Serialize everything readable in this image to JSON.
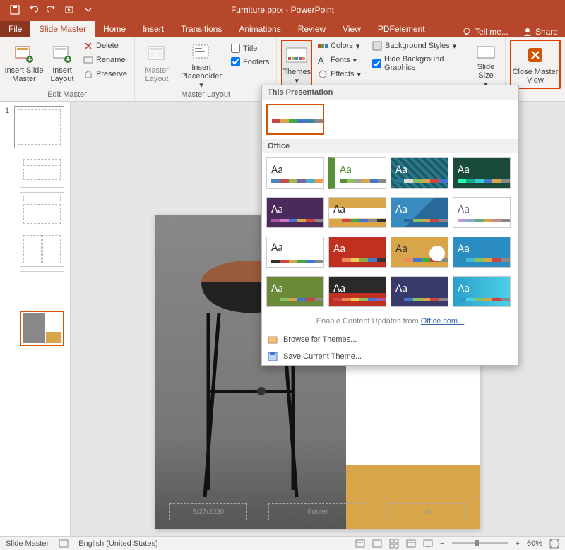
{
  "titlebar": {
    "filename": "Furniture.pptx - PowerPoint"
  },
  "tabs": {
    "file": "File",
    "slide_master": "Slide Master",
    "home": "Home",
    "insert": "Insert",
    "transitions": "Transitions",
    "animations": "Animations",
    "review": "Review",
    "view": "View",
    "pdfelement": "PDFelement",
    "tell_me": "Tell me...",
    "share": "Share"
  },
  "ribbon": {
    "edit_master": {
      "insert_slide_master": "Insert Slide Master",
      "insert_layout": "Insert Layout",
      "delete": "Delete",
      "rename": "Rename",
      "preserve": "Preserve",
      "group_label": "Edit Master"
    },
    "master_layout": {
      "master_layout": "Master Layout",
      "insert_placeholder": "Insert Placeholder",
      "title": "Title",
      "footers": "Footers",
      "group_label": "Master Layout"
    },
    "edit_theme": {
      "themes": "Themes",
      "colors": "Colors",
      "fonts": "Fonts",
      "effects": "Effects",
      "background_styles": "Background Styles",
      "hide_bg": "Hide Background Graphics"
    },
    "size": {
      "slide_size": "Slide Size"
    },
    "close": {
      "close_master_view": "Close Master View"
    }
  },
  "themes_dropdown": {
    "this_presentation": "This Presentation",
    "office": "Office",
    "content_updates_pre": "Enable Content Updates from ",
    "content_updates_link": "Office.com...",
    "browse": "Browse for Themes...",
    "save_current": "Save Current Theme..."
  },
  "slide_placeholders": {
    "date": "5/27/2020",
    "footer": "Footer",
    "slidenum": "‹#›"
  },
  "thumbs": {
    "master_num": "1"
  },
  "statusbar": {
    "mode": "Slide Master",
    "language": "English (United States)",
    "zoom": "60%"
  }
}
